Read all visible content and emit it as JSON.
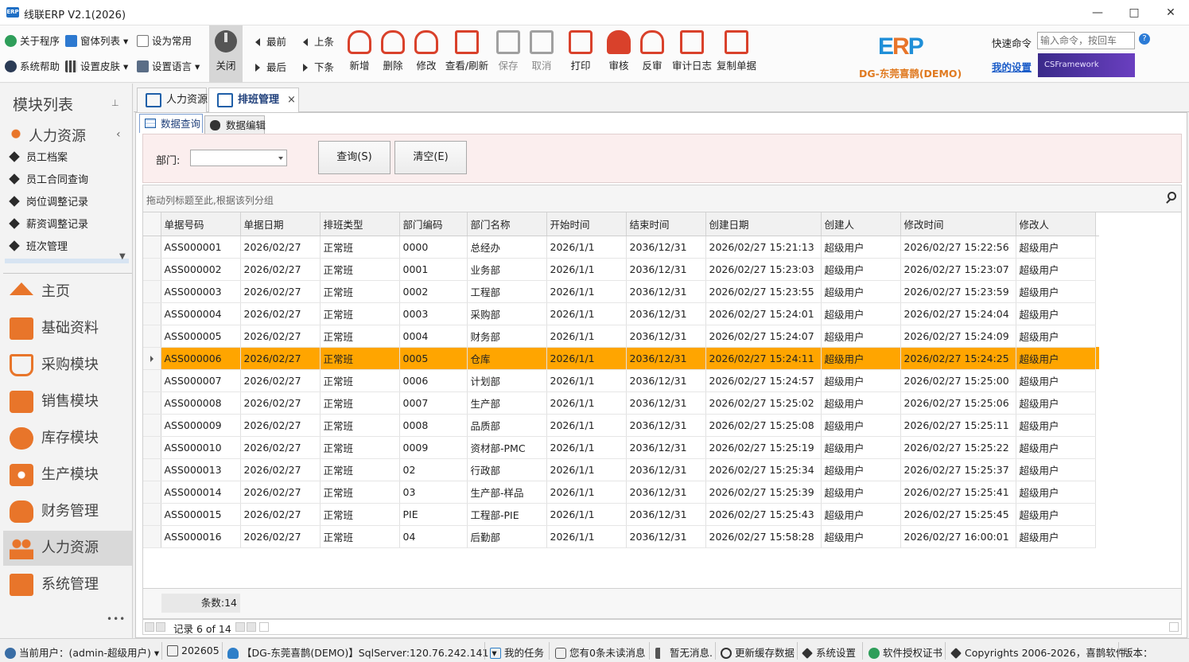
{
  "window": {
    "title": "线联ERP V2.1(2026)",
    "icon_text": "ERP"
  },
  "ribbon": {
    "small_left": [
      "关于程序",
      "窗体列表",
      "设为常用",
      "系统帮助",
      "设置皮肤",
      "设置语言"
    ],
    "close": "关闭",
    "nav": {
      "first": "最前",
      "prev": "上条",
      "last": "最后",
      "next": "下条"
    },
    "buttons": [
      "新增",
      "删除",
      "修改",
      "查看/刷新",
      "保存",
      "取消",
      "打印",
      "审核",
      "反审",
      "审计日志",
      "复制单据"
    ],
    "logo_company": "DG-东莞喜鹊(DEMO)",
    "quick_cmd_label": "快速命令",
    "quick_cmd_placeholder": "输入命令，按回车",
    "my_settings": "我的设置",
    "banner": "CSFramework",
    "help": "?"
  },
  "left_panel": {
    "header": "模块列表",
    "group": "人力资源",
    "sub_items": [
      "员工档案",
      "员工合同查询",
      "岗位调整记录",
      "薪资调整记录",
      "班次管理"
    ],
    "modules": [
      "主页",
      "基础资料",
      "采购模块",
      "销售模块",
      "库存模块",
      "生产模块",
      "财务管理",
      "人力资源",
      "系统管理"
    ],
    "more": "•••"
  },
  "tabs": {
    "doc": [
      "人力资源",
      "排班管理"
    ],
    "sub": [
      "数据查询",
      "数据编辑"
    ],
    "close": "×"
  },
  "search": {
    "dept_label": "部门:",
    "query_btn": "查询(S)",
    "clear_btn": "清空(E)"
  },
  "grid": {
    "group_hint": "拖动列标题至此,根据该列分组",
    "columns": [
      "单据号码",
      "单据日期",
      "排班类型",
      "部门编码",
      "部门名称",
      "开始时间",
      "结束时间",
      "创建日期",
      "创建人",
      "修改时间",
      "修改人"
    ],
    "selected_index": 5,
    "rows": [
      [
        "ASS000001",
        "2026/02/27",
        "正常班",
        "0000",
        "总经办",
        "2026/1/1",
        "2036/12/31",
        "2026/02/27 15:21:13",
        "超级用户",
        "2026/02/27 15:22:56",
        "超级用户"
      ],
      [
        "ASS000002",
        "2026/02/27",
        "正常班",
        "0001",
        "业务部",
        "2026/1/1",
        "2036/12/31",
        "2026/02/27 15:23:03",
        "超级用户",
        "2026/02/27 15:23:07",
        "超级用户"
      ],
      [
        "ASS000003",
        "2026/02/27",
        "正常班",
        "0002",
        "工程部",
        "2026/1/1",
        "2036/12/31",
        "2026/02/27 15:23:55",
        "超级用户",
        "2026/02/27 15:23:59",
        "超级用户"
      ],
      [
        "ASS000004",
        "2026/02/27",
        "正常班",
        "0003",
        "采购部",
        "2026/1/1",
        "2036/12/31",
        "2026/02/27 15:24:01",
        "超级用户",
        "2026/02/27 15:24:04",
        "超级用户"
      ],
      [
        "ASS000005",
        "2026/02/27",
        "正常班",
        "0004",
        "财务部",
        "2026/1/1",
        "2036/12/31",
        "2026/02/27 15:24:07",
        "超级用户",
        "2026/02/27 15:24:09",
        "超级用户"
      ],
      [
        "ASS000006",
        "2026/02/27",
        "正常班",
        "0005",
        "仓库",
        "2026/1/1",
        "2036/12/31",
        "2026/02/27 15:24:11",
        "超级用户",
        "2026/02/27 15:24:25",
        "超级用户"
      ],
      [
        "ASS000007",
        "2026/02/27",
        "正常班",
        "0006",
        "计划部",
        "2026/1/1",
        "2036/12/31",
        "2026/02/27 15:24:57",
        "超级用户",
        "2026/02/27 15:25:00",
        "超级用户"
      ],
      [
        "ASS000008",
        "2026/02/27",
        "正常班",
        "0007",
        "生产部",
        "2026/1/1",
        "2036/12/31",
        "2026/02/27 15:25:02",
        "超级用户",
        "2026/02/27 15:25:06",
        "超级用户"
      ],
      [
        "ASS000009",
        "2026/02/27",
        "正常班",
        "0008",
        "品质部",
        "2026/1/1",
        "2036/12/31",
        "2026/02/27 15:25:08",
        "超级用户",
        "2026/02/27 15:25:11",
        "超级用户"
      ],
      [
        "ASS000010",
        "2026/02/27",
        "正常班",
        "0009",
        "资材部-PMC",
        "2026/1/1",
        "2036/12/31",
        "2026/02/27 15:25:19",
        "超级用户",
        "2026/02/27 15:25:22",
        "超级用户"
      ],
      [
        "ASS000013",
        "2026/02/27",
        "正常班",
        "02",
        "行政部",
        "2026/1/1",
        "2036/12/31",
        "2026/02/27 15:25:34",
        "超级用户",
        "2026/02/27 15:25:37",
        "超级用户"
      ],
      [
        "ASS000014",
        "2026/02/27",
        "正常班",
        "03",
        "生产部-样品",
        "2026/1/1",
        "2036/12/31",
        "2026/02/27 15:25:39",
        "超级用户",
        "2026/02/27 15:25:41",
        "超级用户"
      ],
      [
        "ASS000015",
        "2026/02/27",
        "正常班",
        "PIE",
        "工程部-PIE",
        "2026/1/1",
        "2036/12/31",
        "2026/02/27 15:25:43",
        "超级用户",
        "2026/02/27 15:25:45",
        "超级用户"
      ],
      [
        "ASS000016",
        "2026/02/27",
        "正常班",
        "04",
        "后勤部",
        "2026/1/1",
        "2036/12/31",
        "2026/02/27 15:58:28",
        "超级用户",
        "2026/02/27 16:00:01",
        "超级用户"
      ]
    ],
    "count": "条数:14",
    "record": "记录 6 of 14"
  },
  "status": {
    "user": "当前用户：(admin-超级用户)",
    "period": "202605",
    "db": "【DG-东莞喜鹊(DEMO)】SqlServer:120.76.242.141",
    "tasks": "我的任务",
    "unread": "您有0条未读消息",
    "msg": "暂无消息.",
    "cache": "更新缓存数据",
    "settings": "系统设置",
    "license": "软件授权证书",
    "copyright": "Copyrights 2006-2026，喜鹊软件",
    "version": "版本："
  },
  "colors": {
    "accent": "#ffa500",
    "ribbon_red": "#d9412b",
    "blue": "#1f5fa8"
  }
}
